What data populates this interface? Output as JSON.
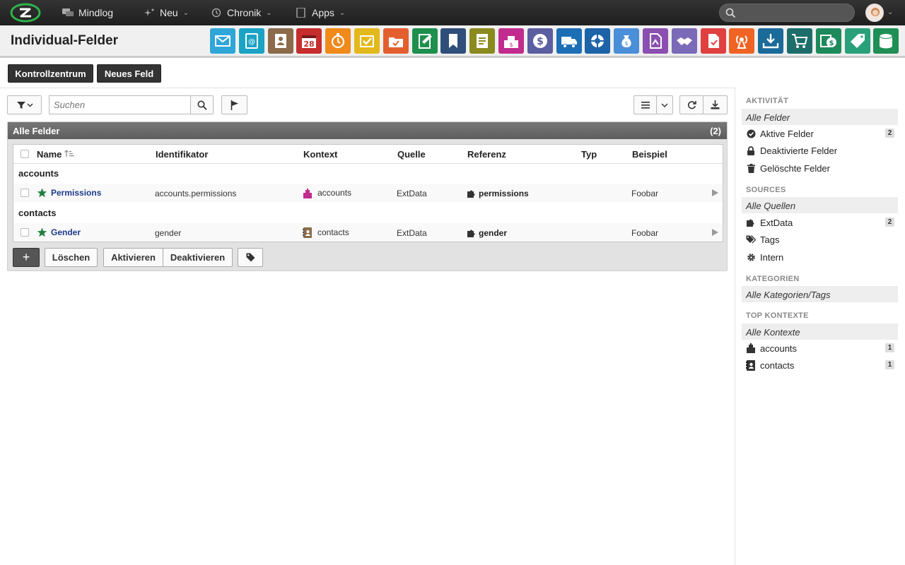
{
  "topbar": {
    "nav": [
      {
        "label": "Mindlog",
        "icon": "chat-icon"
      },
      {
        "label": "Neu",
        "icon": "sparkle-icon"
      },
      {
        "label": "Chronik",
        "icon": "history-icon"
      },
      {
        "label": "Apps",
        "icon": "tablet-icon"
      }
    ],
    "search_placeholder": ""
  },
  "page": {
    "title": "Individual-Felder",
    "app_icons": [
      {
        "name": "mail-app-icon",
        "color": "#2fa6d8"
      },
      {
        "name": "address-book-app-icon",
        "color": "#1aa3c5"
      },
      {
        "name": "contacts-app-icon",
        "color": "#8b6b4a"
      },
      {
        "name": "calendar-app-icon",
        "color": "#c62d2d"
      },
      {
        "name": "timer-app-icon",
        "color": "#f08a1b"
      },
      {
        "name": "tasks-app-icon",
        "color": "#e3b81c"
      },
      {
        "name": "projects-app-icon",
        "color": "#e45f2f"
      },
      {
        "name": "notes-app-icon",
        "color": "#1e8f4d"
      },
      {
        "name": "bookmarks-app-icon",
        "color": "#2f4f7a"
      },
      {
        "name": "documents-app-icon",
        "color": "#8b8a1e"
      },
      {
        "name": "sales-app-icon",
        "color": "#c22c8e"
      },
      {
        "name": "finance-app-icon",
        "color": "#5b5ea0"
      },
      {
        "name": "delivery-app-icon",
        "color": "#1c6fb5"
      },
      {
        "name": "support-app-icon",
        "color": "#1c63a8"
      },
      {
        "name": "money-bag-app-icon",
        "color": "#4a8fd8"
      },
      {
        "name": "contracts-app-icon",
        "color": "#8a4fb0"
      },
      {
        "name": "partners-app-icon",
        "color": "#7a6ab8"
      },
      {
        "name": "pdf-app-icon",
        "color": "#e04040"
      },
      {
        "name": "broadcast-app-icon",
        "color": "#ef6424"
      },
      {
        "name": "download-app-icon",
        "color": "#1a6a9a"
      },
      {
        "name": "shop-app-icon",
        "color": "#1d6e6a"
      },
      {
        "name": "billing-app-icon",
        "color": "#1e8a5c"
      },
      {
        "name": "price-tag-app-icon",
        "color": "#2aa07a"
      },
      {
        "name": "database-app-icon",
        "color": "#1f8f55"
      }
    ]
  },
  "actions": {
    "kontrollzentrum": "Kontrollzentrum",
    "neues_feld": "Neues Feld"
  },
  "toolbar": {
    "search_placeholder": "Suchen"
  },
  "panel": {
    "title": "Alle Felder",
    "count": "(2)",
    "columns": [
      "Name",
      "Identifikator",
      "Kontext",
      "Quelle",
      "Referenz",
      "Typ",
      "Beispiel"
    ],
    "groups": [
      {
        "label": "accounts",
        "row": {
          "name": "Permissions",
          "identifier": "accounts.permissions",
          "context": "accounts",
          "source": "ExtData",
          "reference": "permissions",
          "type": "",
          "example": "Foobar"
        }
      },
      {
        "label": "contacts",
        "row": {
          "name": "Gender",
          "identifier": "gender",
          "context": "contacts",
          "source": "ExtData",
          "reference": "gender",
          "type": "",
          "example": "Foobar"
        }
      }
    ],
    "buttons": {
      "add": "+",
      "delete": "Löschen",
      "activate": "Aktivieren",
      "deactivate": "Deaktivieren"
    }
  },
  "sidebar": {
    "activity": {
      "heading": "AKTIVITÄT",
      "all": "Alle Felder",
      "items": [
        {
          "label": "Aktive Felder",
          "badge": "2"
        },
        {
          "label": "Deaktivierte Felder",
          "badge": ""
        },
        {
          "label": "Gelöschte Felder",
          "badge": ""
        }
      ]
    },
    "sources": {
      "heading": "SOURCES",
      "all": "Alle Quellen",
      "items": [
        {
          "label": "ExtData",
          "badge": "2"
        },
        {
          "label": "Tags",
          "badge": ""
        },
        {
          "label": "Intern",
          "badge": ""
        }
      ]
    },
    "categories": {
      "heading": "KATEGORIEN",
      "all": "Alle Kategorien/Tags"
    },
    "contexts": {
      "heading": "TOP KONTEXTE",
      "all": "Alle Kontexte",
      "items": [
        {
          "label": "accounts",
          "badge": "1"
        },
        {
          "label": "contacts",
          "badge": "1"
        }
      ]
    }
  }
}
